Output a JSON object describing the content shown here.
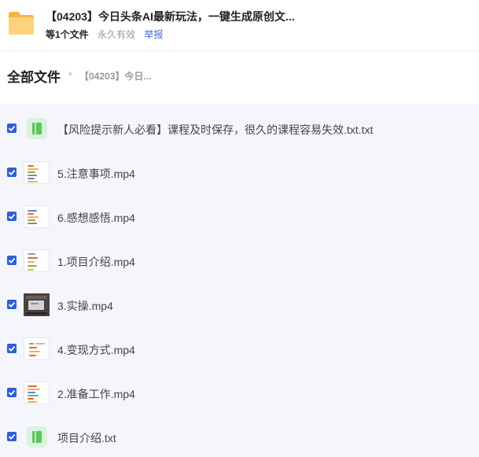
{
  "share": {
    "title": "【04203】今日头条AI最新玩法，一键生成原创文...",
    "file_count": "等1个文件",
    "validity": "永久有效",
    "report": "举报"
  },
  "breadcrumb": {
    "root": "全部文件",
    "current": "【04203】今日..."
  },
  "files": [
    {
      "name": "【风险提示新人必看】课程及时保存，很久的课程容易失效.txt.txt",
      "type": "txt-icon",
      "checked": true
    },
    {
      "name": "5.注意事项.mp4",
      "type": "video-thumbnail",
      "checked": true
    },
    {
      "name": "6.感想感悟.mp4",
      "type": "video-thumbnail",
      "checked": true
    },
    {
      "name": "1.项目介绍.mp4",
      "type": "video-thumbnail",
      "checked": true
    },
    {
      "name": "3.实操.mp4",
      "type": "video-thumbnail-dark",
      "checked": true
    },
    {
      "name": "4.变现方式.mp4",
      "type": "video-thumbnail",
      "checked": true
    },
    {
      "name": "2.准备工作.mp4",
      "type": "video-thumbnail",
      "checked": true
    },
    {
      "name": "项目介绍.txt",
      "type": "txt-icon",
      "checked": true
    }
  ],
  "colors": {
    "accent": "#2b5fe0",
    "folder": "#f6b73c",
    "txt_icon": "#5cc65e",
    "list_bg": "#f5f6fb"
  }
}
